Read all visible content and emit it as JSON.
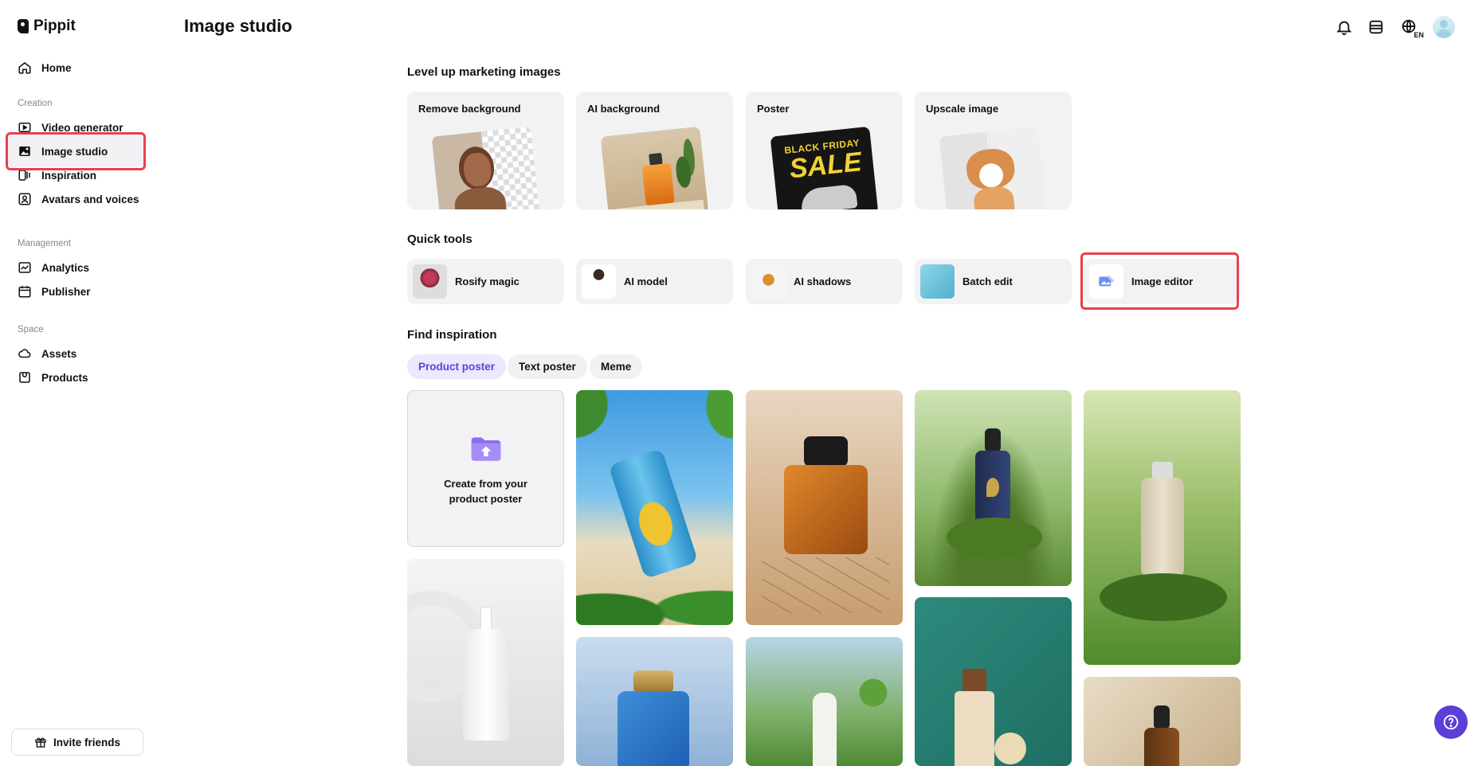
{
  "app": {
    "name": "Pippit",
    "page_title": "Image studio"
  },
  "sidebar": {
    "items": [
      {
        "label": "Home",
        "icon": "home-icon"
      },
      {
        "label": "Video generator",
        "icon": "video-icon"
      },
      {
        "label": "Image studio",
        "icon": "image-icon",
        "active": true
      },
      {
        "label": "Inspiration",
        "icon": "inspiration-icon"
      },
      {
        "label": "Avatars and voices",
        "icon": "avatar-icon"
      },
      {
        "label": "Analytics",
        "icon": "analytics-icon"
      },
      {
        "label": "Publisher",
        "icon": "calendar-icon"
      },
      {
        "label": "Assets",
        "icon": "cloud-icon"
      },
      {
        "label": "Products",
        "icon": "product-icon"
      }
    ],
    "sections": {
      "creation": "Creation",
      "management": "Management",
      "space": "Space"
    },
    "invite_label": "Invite friends"
  },
  "header": {
    "icons": [
      "bell-icon",
      "credits-icon",
      "language-icon",
      "avatar"
    ],
    "language_badge": "EN"
  },
  "marketing": {
    "title": "Level up marketing images",
    "cards": [
      {
        "label": "Remove background"
      },
      {
        "label": "AI background"
      },
      {
        "label": "Poster",
        "art_text_top": "BLACK FRIDAY",
        "art_text_bottom": "SALE"
      },
      {
        "label": "Upscale image"
      }
    ]
  },
  "quick_tools": {
    "title": "Quick tools",
    "items": [
      {
        "label": "Rosify magic"
      },
      {
        "label": "AI model"
      },
      {
        "label": "AI shadows"
      },
      {
        "label": "Batch edit"
      },
      {
        "label": "Image editor"
      }
    ]
  },
  "inspiration": {
    "title": "Find inspiration",
    "tabs": [
      {
        "label": "Product poster",
        "active": true
      },
      {
        "label": "Text poster"
      },
      {
        "label": "Meme"
      }
    ],
    "create_label_line1": "Create from your",
    "create_label_line2": "product poster"
  },
  "colors": {
    "accent": "#5b3fd6",
    "highlight": "#e8404f",
    "card_bg": "#f2f2f4"
  }
}
